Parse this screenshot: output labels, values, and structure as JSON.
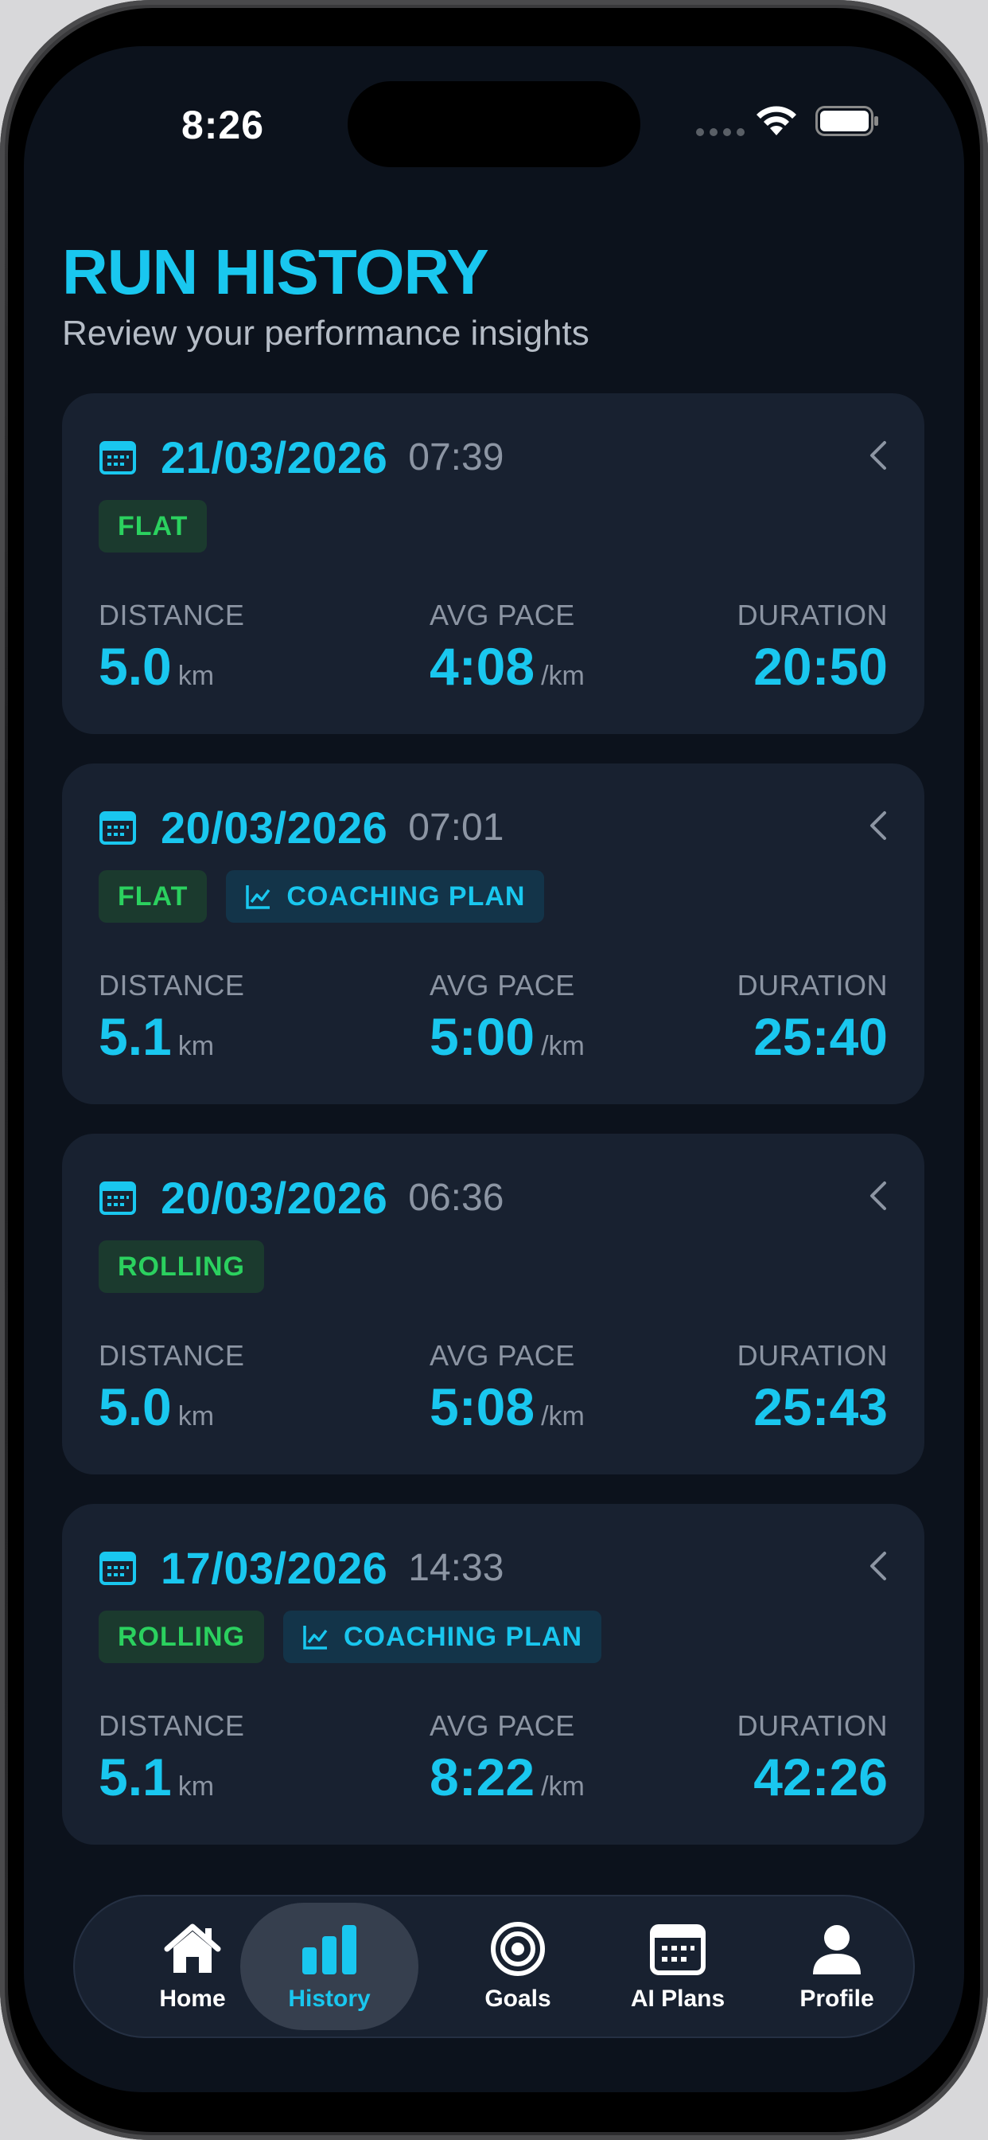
{
  "status_bar": {
    "time": "8:26"
  },
  "header": {
    "title": "RUN HISTORY",
    "subtitle": "Review your performance insights"
  },
  "labels": {
    "distance": "DISTANCE",
    "avg_pace": "AVG PACE",
    "duration": "DURATION",
    "km_unit": "km",
    "pace_unit": "/km"
  },
  "runs": [
    {
      "date": "21/03/2026",
      "time": "07:39",
      "terrain": "FLAT",
      "coaching": "",
      "distance": "5.0",
      "pace": "4:08",
      "duration": "20:50"
    },
    {
      "date": "20/03/2026",
      "time": "07:01",
      "terrain": "FLAT",
      "coaching": "COACHING PLAN",
      "distance": "5.1",
      "pace": "5:00",
      "duration": "25:40"
    },
    {
      "date": "20/03/2026",
      "time": "06:36",
      "terrain": "ROLLING",
      "coaching": "",
      "distance": "5.0",
      "pace": "5:08",
      "duration": "25:43"
    },
    {
      "date": "17/03/2026",
      "time": "14:33",
      "terrain": "ROLLING",
      "coaching": "COACHING PLAN",
      "distance": "5.1",
      "pace": "8:22",
      "duration": "42:26"
    }
  ],
  "tabbar": {
    "active": "History",
    "items": [
      {
        "label": "Home",
        "icon": "home-icon"
      },
      {
        "label": "History",
        "icon": "bar-chart-icon"
      },
      {
        "label": "Goals",
        "icon": "target-icon"
      },
      {
        "label": "AI Plans",
        "icon": "calendar-icon"
      },
      {
        "label": "Profile",
        "icon": "person-icon"
      }
    ]
  },
  "colors": {
    "accent": "#19c7ef",
    "background": "#0c121c",
    "card": "#182130",
    "terrain_tag": "#2bd15f",
    "muted": "#8c95a3"
  }
}
